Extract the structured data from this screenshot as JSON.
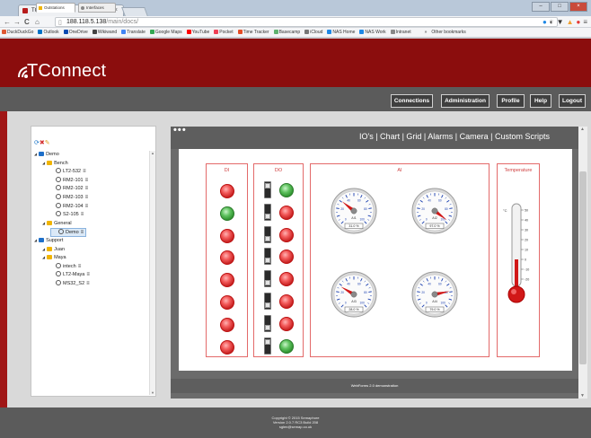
{
  "browser": {
    "tab_title": "TConnect",
    "url_host": "188.118.5.138",
    "url_path": "/main/docs/",
    "bookmarks": [
      {
        "label": "DuckDuckGo",
        "color": "#de5833"
      },
      {
        "label": "Outlook",
        "color": "#0072c6"
      },
      {
        "label": "OneDrive",
        "color": "#094ab2"
      },
      {
        "label": "Wikiwand",
        "color": "#444444"
      },
      {
        "label": "Translate",
        "color": "#4285f4"
      },
      {
        "label": "Google Maps",
        "color": "#34a853"
      },
      {
        "label": "YouTube",
        "color": "#ff0000"
      },
      {
        "label": "Pocket",
        "color": "#ef4056"
      },
      {
        "label": "Time Tracker",
        "color": "#e44d26"
      },
      {
        "label": "Basecamp",
        "color": "#5eb26e"
      },
      {
        "label": "iCloud",
        "color": "#777777"
      },
      {
        "label": "NAS Home",
        "color": "#1e88e5"
      },
      {
        "label": "NAS Work",
        "color": "#1e88e5"
      },
      {
        "label": "Intranet",
        "color": "#888888"
      }
    ],
    "overflow_label": "»",
    "other_bookmarks": "Other bookmarks"
  },
  "app": {
    "brand": "TConnect",
    "brand_color": "#8b0d0d",
    "nav": [
      "Connections",
      "Administration",
      "Profile",
      "Help",
      "Logout"
    ]
  },
  "tree": {
    "tabs": [
      "Outstations",
      "Interfaces"
    ],
    "nodes": [
      {
        "label": "Demo",
        "level": 0,
        "icon": "folder-blue-icon",
        "menu": false
      },
      {
        "label": "Bench",
        "level": 1,
        "icon": "folder-yellow-icon",
        "menu": false
      },
      {
        "label": "LT2-532",
        "level": 2,
        "icon": "station-icon",
        "menu": true
      },
      {
        "label": "RM2-101",
        "level": 2,
        "icon": "station-icon",
        "menu": true
      },
      {
        "label": "RM2-102",
        "level": 2,
        "icon": "station-icon",
        "menu": true
      },
      {
        "label": "RM2-103",
        "level": 2,
        "icon": "station-icon",
        "menu": true
      },
      {
        "label": "RM2-104",
        "level": 2,
        "icon": "station-icon",
        "menu": true
      },
      {
        "label": "S2-105",
        "level": 2,
        "icon": "station-icon",
        "menu": true
      },
      {
        "label": "General",
        "level": 1,
        "icon": "folder-yellow-icon",
        "menu": false
      },
      {
        "label": "Demo",
        "level": 2,
        "icon": "station-icon",
        "menu": true,
        "selected": true
      },
      {
        "label": "Support",
        "level": 0,
        "icon": "folder-blue-icon",
        "menu": false
      },
      {
        "label": "Juan",
        "level": 1,
        "icon": "folder-yellow-icon",
        "menu": false
      },
      {
        "label": "Maya",
        "level": 1,
        "icon": "folder-yellow-icon",
        "menu": false
      },
      {
        "label": "intech",
        "level": 2,
        "icon": "station-icon",
        "menu": true
      },
      {
        "label": "LT2-Maya",
        "level": 2,
        "icon": "station-icon",
        "menu": true
      },
      {
        "label": "MS32_S2",
        "level": 2,
        "icon": "station-icon",
        "menu": true
      }
    ]
  },
  "content": {
    "menu": "IO's | Chart | Grid | Alarms | Camera | Custom Scripts",
    "footer": "WebForms 2.0 demonstration",
    "panels": {
      "di": "DI",
      "do": "DO",
      "ai": "AI",
      "temp": "Temperature"
    },
    "di_states": [
      "red",
      "green",
      "red",
      "red",
      "red",
      "red",
      "red",
      "red"
    ],
    "do_states": [
      "green",
      "red",
      "red",
      "red",
      "red",
      "red",
      "red",
      "green"
    ],
    "gauges": [
      {
        "label": "AI1",
        "value": 31.0,
        "readout": "31.0 %"
      },
      {
        "label": "AI2",
        "value": 97.0,
        "readout": "97.0 %"
      },
      {
        "label": "AI3",
        "value": 28.0,
        "readout": "28.0 %"
      },
      {
        "label": "AI4",
        "value": 79.0,
        "readout": "79.0 %"
      }
    ],
    "thermometer": {
      "unit": "°C",
      "ticks": [
        "50",
        "40",
        "30",
        "20",
        "10",
        "0",
        "-10",
        "-20"
      ],
      "value": 0
    }
  },
  "footer": {
    "line1": "Copyright © 2015 Semaphore",
    "line2": "Version 2.0.7 RC3 Build 208",
    "line3": "sglen@semap.co.uk"
  }
}
